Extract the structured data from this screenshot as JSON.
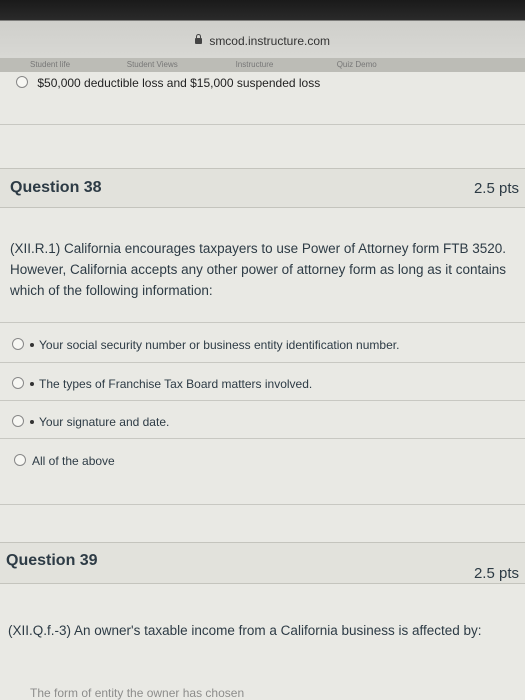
{
  "browser": {
    "url": "smcod.instructure.com",
    "tabs": [
      "Student life",
      "Student Views",
      "Instructure",
      "Quiz Demo"
    ]
  },
  "previous_question": {
    "option_text": "$50,000 deductible loss and $15,000 suspended loss"
  },
  "q38": {
    "title": "Question 38",
    "points": "2.5 pts",
    "text": "(XII.R.1) California encourages taxpayers to use Power of Attorney form FTB 3520. However, California accepts any other power of attorney form as long as it contains which of the following information:",
    "options": [
      "Your social security number or business entity identification number.",
      "The types of Franchise Tax Board matters involved.",
      "Your signature and date.",
      "All of the above"
    ]
  },
  "q39": {
    "title": "Question 39",
    "points": "2.5 pts",
    "text": "(XII.Q.f.-3) An owner's taxable income from a California business is affected by:",
    "option_partial": "The form of entity the owner has chosen"
  }
}
